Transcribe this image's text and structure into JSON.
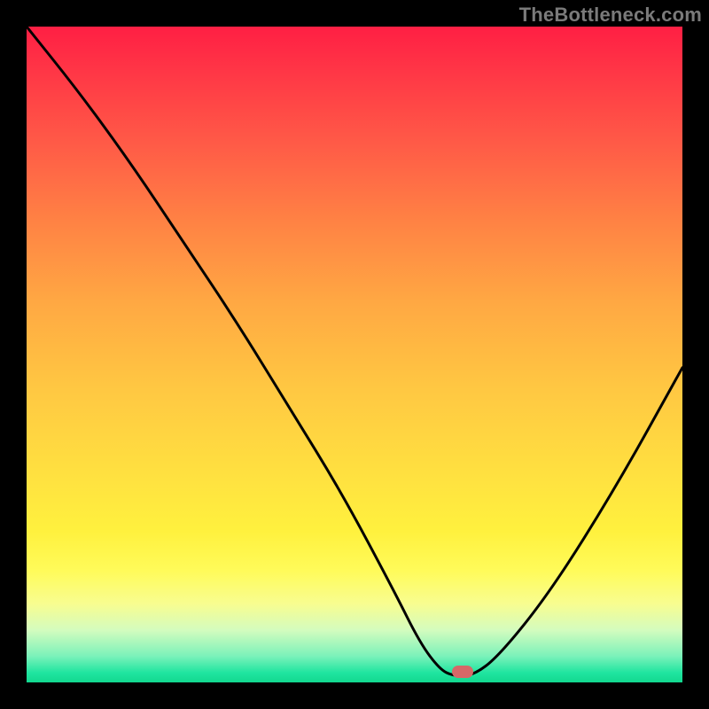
{
  "watermark": "TheBottleneck.com",
  "chart_data": {
    "type": "line",
    "title": "",
    "xlabel": "",
    "ylabel": "",
    "xlim": [
      0,
      100
    ],
    "ylim": [
      0,
      100
    ],
    "grid": false,
    "legend": false,
    "series": [
      {
        "name": "bottleneck-curve",
        "x": [
          0,
          8,
          16,
          24,
          32,
          40,
          48,
          56,
          60,
          63,
          65,
          68,
          72,
          80,
          90,
          100
        ],
        "y": [
          100,
          90,
          79,
          67,
          55,
          42,
          29,
          14,
          6,
          2,
          1,
          1,
          4,
          14,
          30,
          48
        ]
      }
    ],
    "marker": {
      "x": 66.5,
      "y": 1.6
    },
    "gradient_stops": [
      {
        "pct": 0,
        "color": "#ff1f44"
      },
      {
        "pct": 8,
        "color": "#ff3a46"
      },
      {
        "pct": 18,
        "color": "#ff5b47"
      },
      {
        "pct": 30,
        "color": "#ff8344"
      },
      {
        "pct": 42,
        "color": "#ffa843"
      },
      {
        "pct": 55,
        "color": "#ffc742"
      },
      {
        "pct": 68,
        "color": "#ffe040"
      },
      {
        "pct": 77,
        "color": "#fff13e"
      },
      {
        "pct": 83,
        "color": "#fffb5a"
      },
      {
        "pct": 88,
        "color": "#f8fd90"
      },
      {
        "pct": 92,
        "color": "#d4fcbe"
      },
      {
        "pct": 96,
        "color": "#7bf2ba"
      },
      {
        "pct": 98.5,
        "color": "#20e5a0"
      },
      {
        "pct": 100,
        "color": "#12d88f"
      }
    ]
  }
}
